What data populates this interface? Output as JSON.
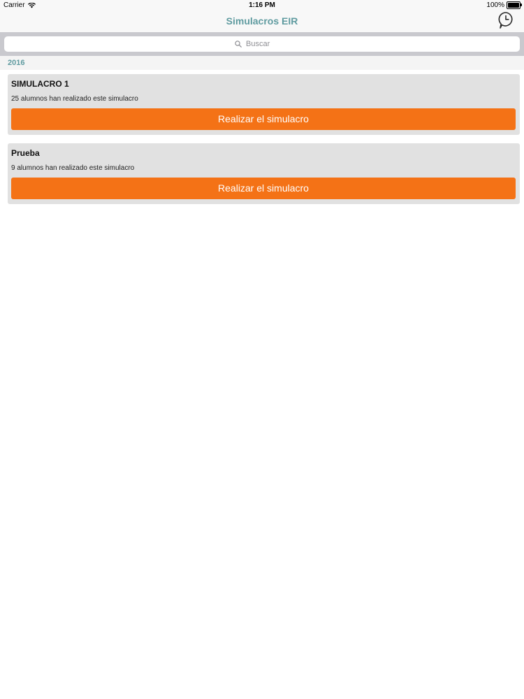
{
  "status_bar": {
    "carrier": "Carrier",
    "time": "1:16 PM",
    "battery": "100%",
    "battery_level": 1.0
  },
  "nav": {
    "title": "Simulacros EIR",
    "right_icon": "clock-speech-icon"
  },
  "search": {
    "placeholder": "Buscar"
  },
  "section": {
    "year": "2016"
  },
  "simulacros": [
    {
      "title": "SIMULACRO 1",
      "subtitle": "25 alumnos han realizado este simulacro",
      "button_label": "Realizar el simulacro"
    },
    {
      "title": "Prueba",
      "subtitle": "9 alumnos han realizado este simulacro",
      "button_label": "Realizar el simulacro"
    }
  ],
  "colors": {
    "accent": "#5f9ba0",
    "button": "#f47216",
    "card": "#e1e1e1"
  }
}
